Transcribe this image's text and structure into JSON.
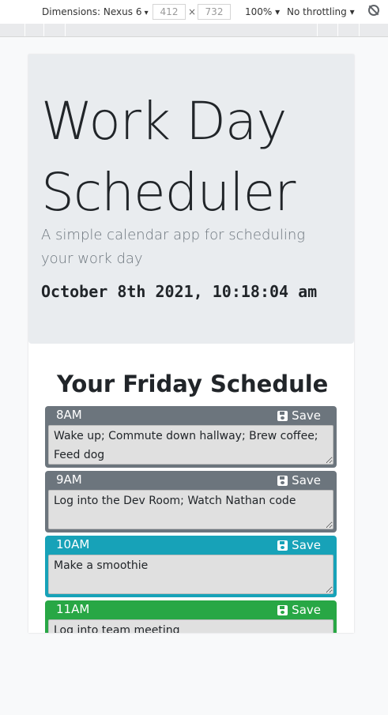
{
  "devtools": {
    "device": "Dimensions: Nexus 6",
    "width": "412",
    "times": "×",
    "height": "732",
    "zoom": "100% ▾",
    "throttling": "No throttling ▾"
  },
  "header": {
    "title": "Work Day Scheduler",
    "lead": "A simple calendar app for scheduling your work day",
    "current_time": "October 8th 2021, 10:18:04 am"
  },
  "schedule": {
    "title": "Your Friday Schedule",
    "save_label": "Save",
    "blocks": [
      {
        "hour": "8AM",
        "text": "Wake up; Commute down hallway; Brew coffee; Feed dog",
        "state": "past"
      },
      {
        "hour": "9AM",
        "text": "Log into the Dev Room; Watch Nathan code",
        "state": "past"
      },
      {
        "hour": "10AM",
        "text": "Make a smoothie",
        "state": "present"
      },
      {
        "hour": "11AM",
        "text": "Log into team meeting",
        "state": "future"
      }
    ]
  },
  "colors": {
    "past": "#6c757d",
    "present": "#17a2b8",
    "future": "#28a745"
  }
}
